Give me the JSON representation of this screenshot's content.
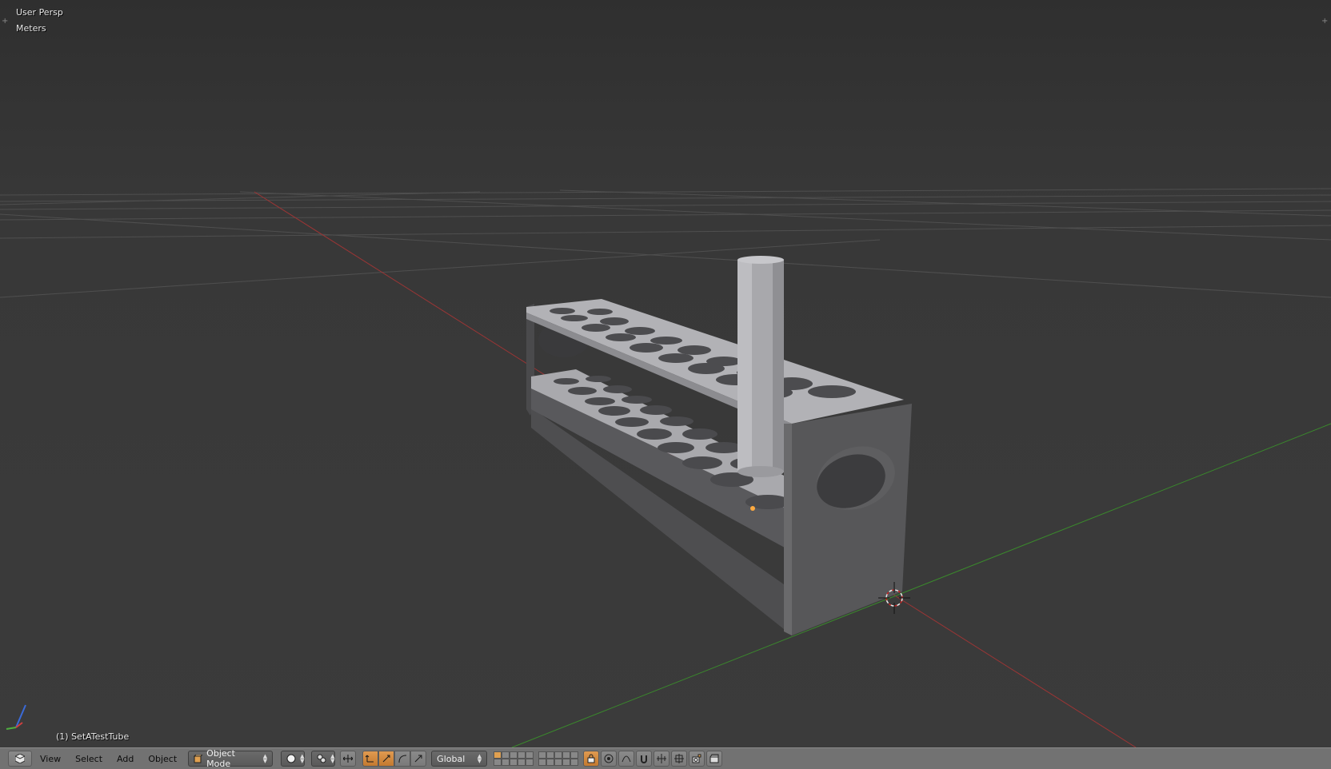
{
  "viewport": {
    "view_name": "User Persp",
    "units": "Meters",
    "active_object": "(1) SetATestTube"
  },
  "header": {
    "editor_type_icon": "3d-view-icon",
    "menus": [
      "View",
      "Select",
      "Add",
      "Object"
    ],
    "mode": "Object Mode",
    "viewport_shading_icon": "solid-sphere-icon",
    "pivot_icon": "pivot-point-icon",
    "transform_orientation": "Global",
    "layers": {
      "active_index": 0,
      "used": [
        0
      ]
    },
    "accent_color": "#e09a50",
    "header_color": "#727272"
  },
  "colors": {
    "background": "#393939",
    "grid": "#4d4d4d",
    "x_axis": "#a23a3a",
    "y_axis": "#3d8a2e",
    "mesh_top": "#b4b4b8",
    "mesh_side": "#5a5a5d"
  }
}
